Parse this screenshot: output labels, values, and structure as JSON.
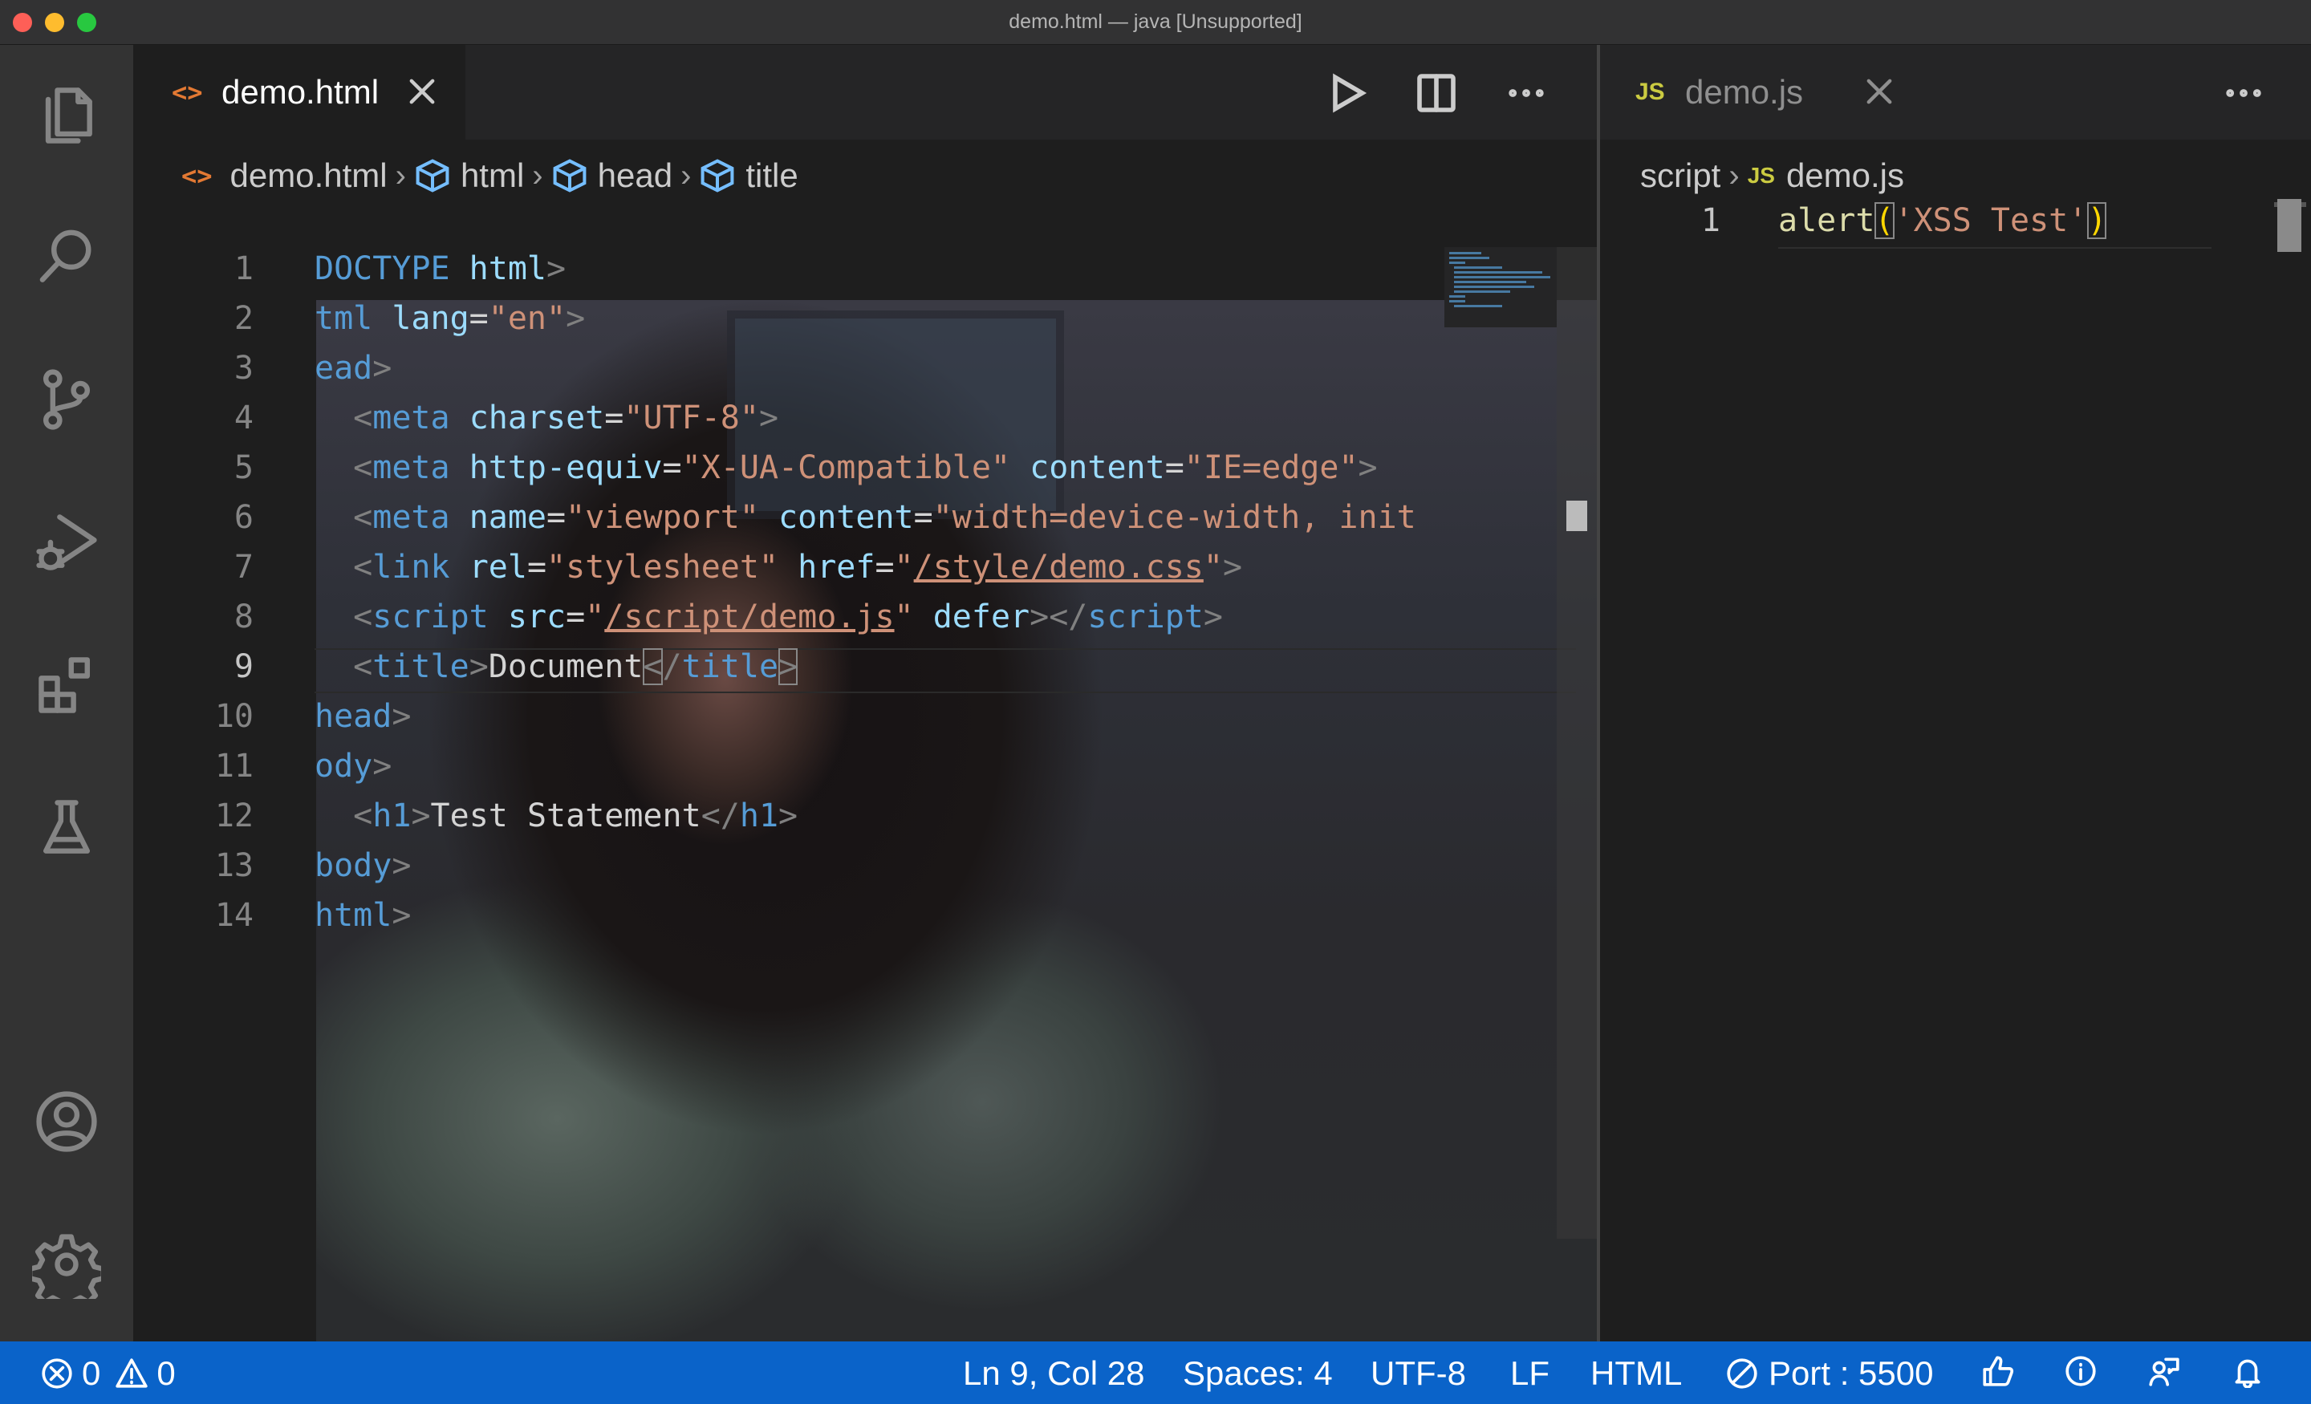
{
  "window": {
    "title": "demo.html — java [Unsupported]"
  },
  "activity_bar": {
    "icons": [
      "files-icon",
      "search-icon",
      "source-control-icon",
      "run-debug-icon",
      "extensions-icon",
      "testing-icon",
      "account-icon",
      "settings-gear-icon"
    ]
  },
  "left_group": {
    "tab": {
      "label": "demo.html",
      "icon": "html-file-icon"
    },
    "breadcrumb": [
      "demo.html",
      "html",
      "head",
      "title"
    ],
    "line_numbers": [
      "1",
      "2",
      "3",
      "4",
      "5",
      "6",
      "7",
      "8",
      "9",
      "10",
      "11",
      "12",
      "13",
      "14"
    ],
    "current_line": "9"
  },
  "right_group": {
    "tab": {
      "label": "demo.js",
      "icon_text": "JS"
    },
    "breadcrumb": [
      "script",
      "demo.js"
    ],
    "line_numbers": [
      "1"
    ],
    "code": {
      "fn": "alert",
      "open": "(",
      "str": "'XSS Test'",
      "close": ")"
    }
  },
  "status_bar": {
    "errors": "0",
    "warnings": "0",
    "position": "Ln 9, Col 28",
    "spaces": "Spaces: 4",
    "encoding": "UTF-8",
    "eol": "LF",
    "language": "HTML",
    "port": "Port : 5500"
  },
  "colors": {
    "status_bar": "#0a63c9",
    "keyword": "#569cd6",
    "attribute": "#9cdcfe",
    "string": "#ce9178"
  }
}
